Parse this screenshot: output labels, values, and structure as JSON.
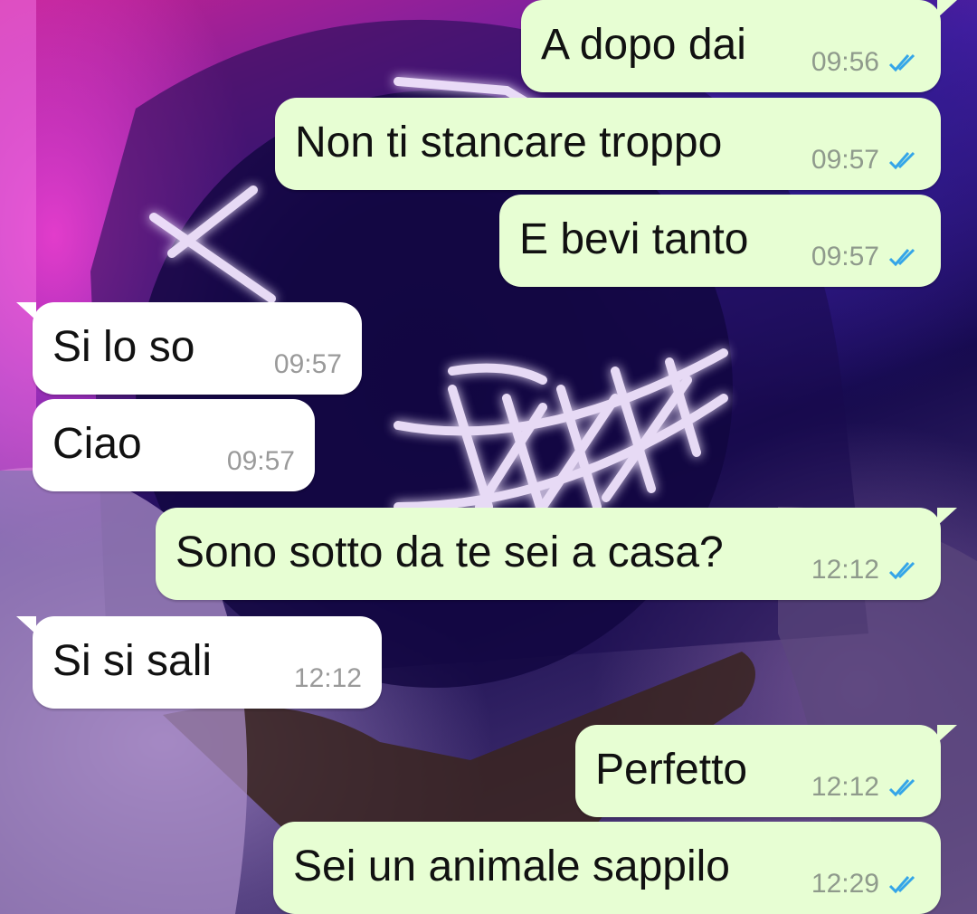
{
  "theme": {
    "outgoing_bubble": "#e7fed3",
    "incoming_bubble": "#ffffff",
    "read_tick_color": "#34a5e8"
  },
  "messages": [
    {
      "direction": "out",
      "text": "A dopo dai",
      "time": "09:56",
      "status": "read-double-tick-icon"
    },
    {
      "direction": "out",
      "text": "Non ti stancare troppo",
      "time": "09:57",
      "status": "read-double-tick-icon"
    },
    {
      "direction": "out",
      "text": "E bevi tanto",
      "time": "09:57",
      "status": "read-double-tick-icon"
    },
    {
      "direction": "in",
      "text": "Si lo so",
      "time": "09:57"
    },
    {
      "direction": "in",
      "text": "Ciao",
      "time": "09:57"
    },
    {
      "direction": "out",
      "text": "Sono sotto da te sei a casa?",
      "time": "12:12",
      "status": "read-double-tick-icon"
    },
    {
      "direction": "in",
      "text": "Si si sali",
      "time": "12:12"
    },
    {
      "direction": "out",
      "text": "Perfetto",
      "time": "12:12",
      "status": "read-double-tick-icon"
    },
    {
      "direction": "out",
      "text": "Sei un animale sappilo",
      "time": "12:29",
      "status": "read-double-tick-icon"
    }
  ]
}
